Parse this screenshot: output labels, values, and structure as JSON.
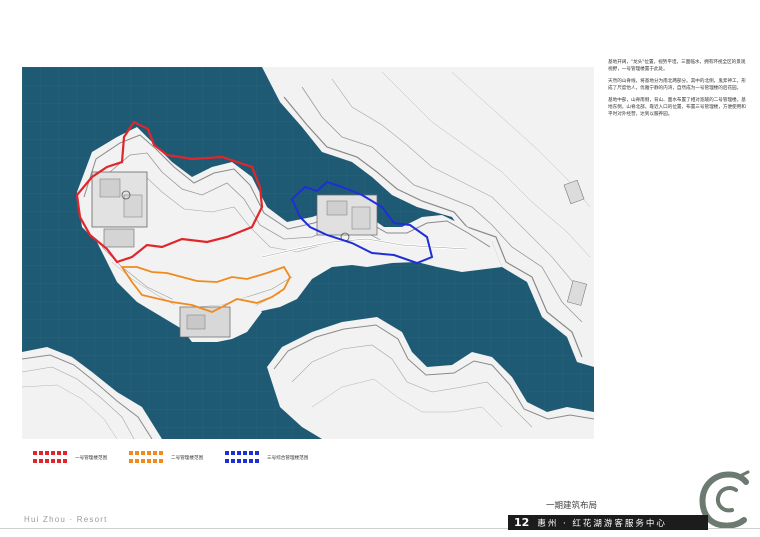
{
  "description": [
    "基地开阔，\"龙头\"位置，视势平坦，三面临水，拥有环视全区的景观视野，一号管理楼置于此处。",
    "天然的山脊线，将基地分为南北两部分。其中的北侧，鬼斧神工，形成了尺度怡人，优雅宁静的内湾，自然成为一号管理楼的后花园。",
    "基地中部，山脊南侧，背山、面水布置了相对宽敞的二号管理楼。基地东侧，山脊北部，靠近入口的位置，布置三号管理楼，方便使用和平时对外经营，达到以服养园。"
  ],
  "legend": [
    {
      "label": "一号管理楼范围",
      "color": "#e0262b"
    },
    {
      "label": "二号管理楼范围",
      "color": "#f08a1d"
    },
    {
      "label": "三号综合管理楼范围",
      "color": "#1f2fd6"
    }
  ],
  "colors": {
    "water": "#1f5a74",
    "land": "#f2f2f2",
    "contour": "#8a8a8a"
  },
  "phase_title": "一期建筑布局",
  "footer": {
    "brand": "Hui Zhou · Resort",
    "page_number": "12",
    "project_title": "惠州 · 红花湖游客服务中心"
  }
}
